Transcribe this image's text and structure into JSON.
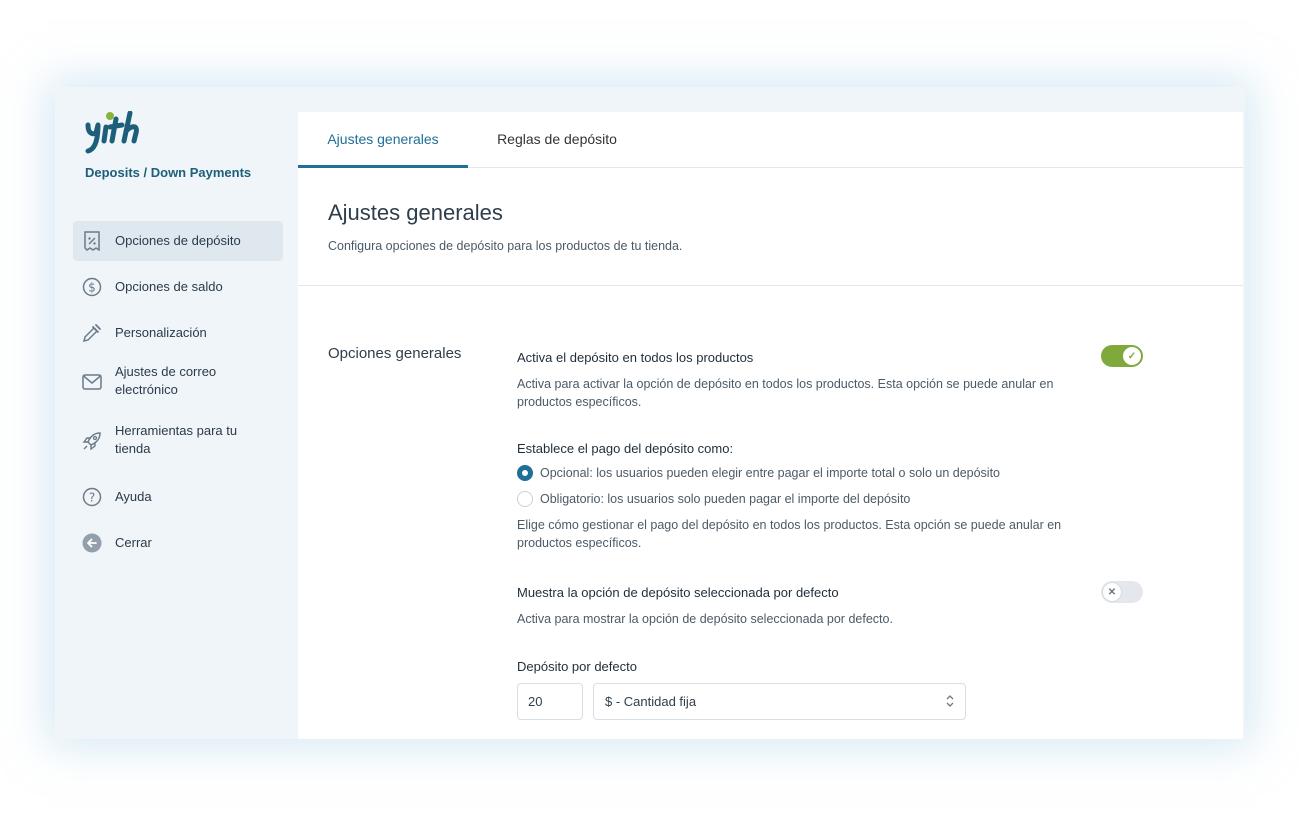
{
  "brand": {
    "logo_text": "yith",
    "plugin_name": "Deposits / Down Payments"
  },
  "sidebar": {
    "items": [
      {
        "label": "Opciones de depósito",
        "icon": "receipt-percent-icon",
        "active": true
      },
      {
        "label": "Opciones de saldo",
        "icon": "dollar-circle-icon",
        "active": false
      },
      {
        "label": "Personalización",
        "icon": "eyedropper-icon",
        "active": false
      },
      {
        "label": "Ajustes de correo electrónico",
        "icon": "envelope-icon",
        "active": false
      },
      {
        "label": "Herramientas para tu tienda",
        "icon": "rocket-icon",
        "active": false
      },
      {
        "label": "Ayuda",
        "icon": "question-circle-icon",
        "active": false
      },
      {
        "label": "Cerrar",
        "icon": "arrow-left-circle-icon",
        "active": false
      }
    ]
  },
  "tabs": [
    {
      "label": "Ajustes generales",
      "active": true
    },
    {
      "label": "Reglas de depósito",
      "active": false
    }
  ],
  "page": {
    "title": "Ajustes generales",
    "description": "Configura opciones de depósito para los productos de tu tienda."
  },
  "section": {
    "title": "Opciones generales"
  },
  "options": {
    "enable_all": {
      "label": "Activa el depósito en todos los productos",
      "description": "Activa para activar la opción de depósito en todos los productos. Esta opción se puede anular en productos específicos.",
      "enabled": true
    },
    "payment_mode": {
      "label": "Establece el pago del depósito como:",
      "choices": [
        {
          "label": "Opcional: los usuarios pueden elegir entre pagar el importe total o solo un depósito",
          "checked": true
        },
        {
          "label": "Obligatorio: los usuarios solo pueden pagar el importe del depósito",
          "checked": false
        }
      ],
      "description": "Elige cómo gestionar el pago del depósito en todos los productos. Esta opción se puede anular en productos específicos."
    },
    "show_default": {
      "label": "Muestra la opción de depósito seleccionada por defecto",
      "description": "Activa para mostrar la opción de depósito seleccionada por defecto.",
      "enabled": false
    },
    "default_deposit": {
      "label": "Depósito por defecto",
      "amount": "20",
      "type_selected": "$ - Cantidad fija"
    }
  },
  "colors": {
    "accent": "#1f6f96",
    "brand_dark": "#1d5f7a",
    "brand_green": "#8bb43c",
    "toggle_on": "#7fa93b",
    "sidebar_bg": "#f0f5f9",
    "active_item_bg": "#dfe8ef"
  }
}
